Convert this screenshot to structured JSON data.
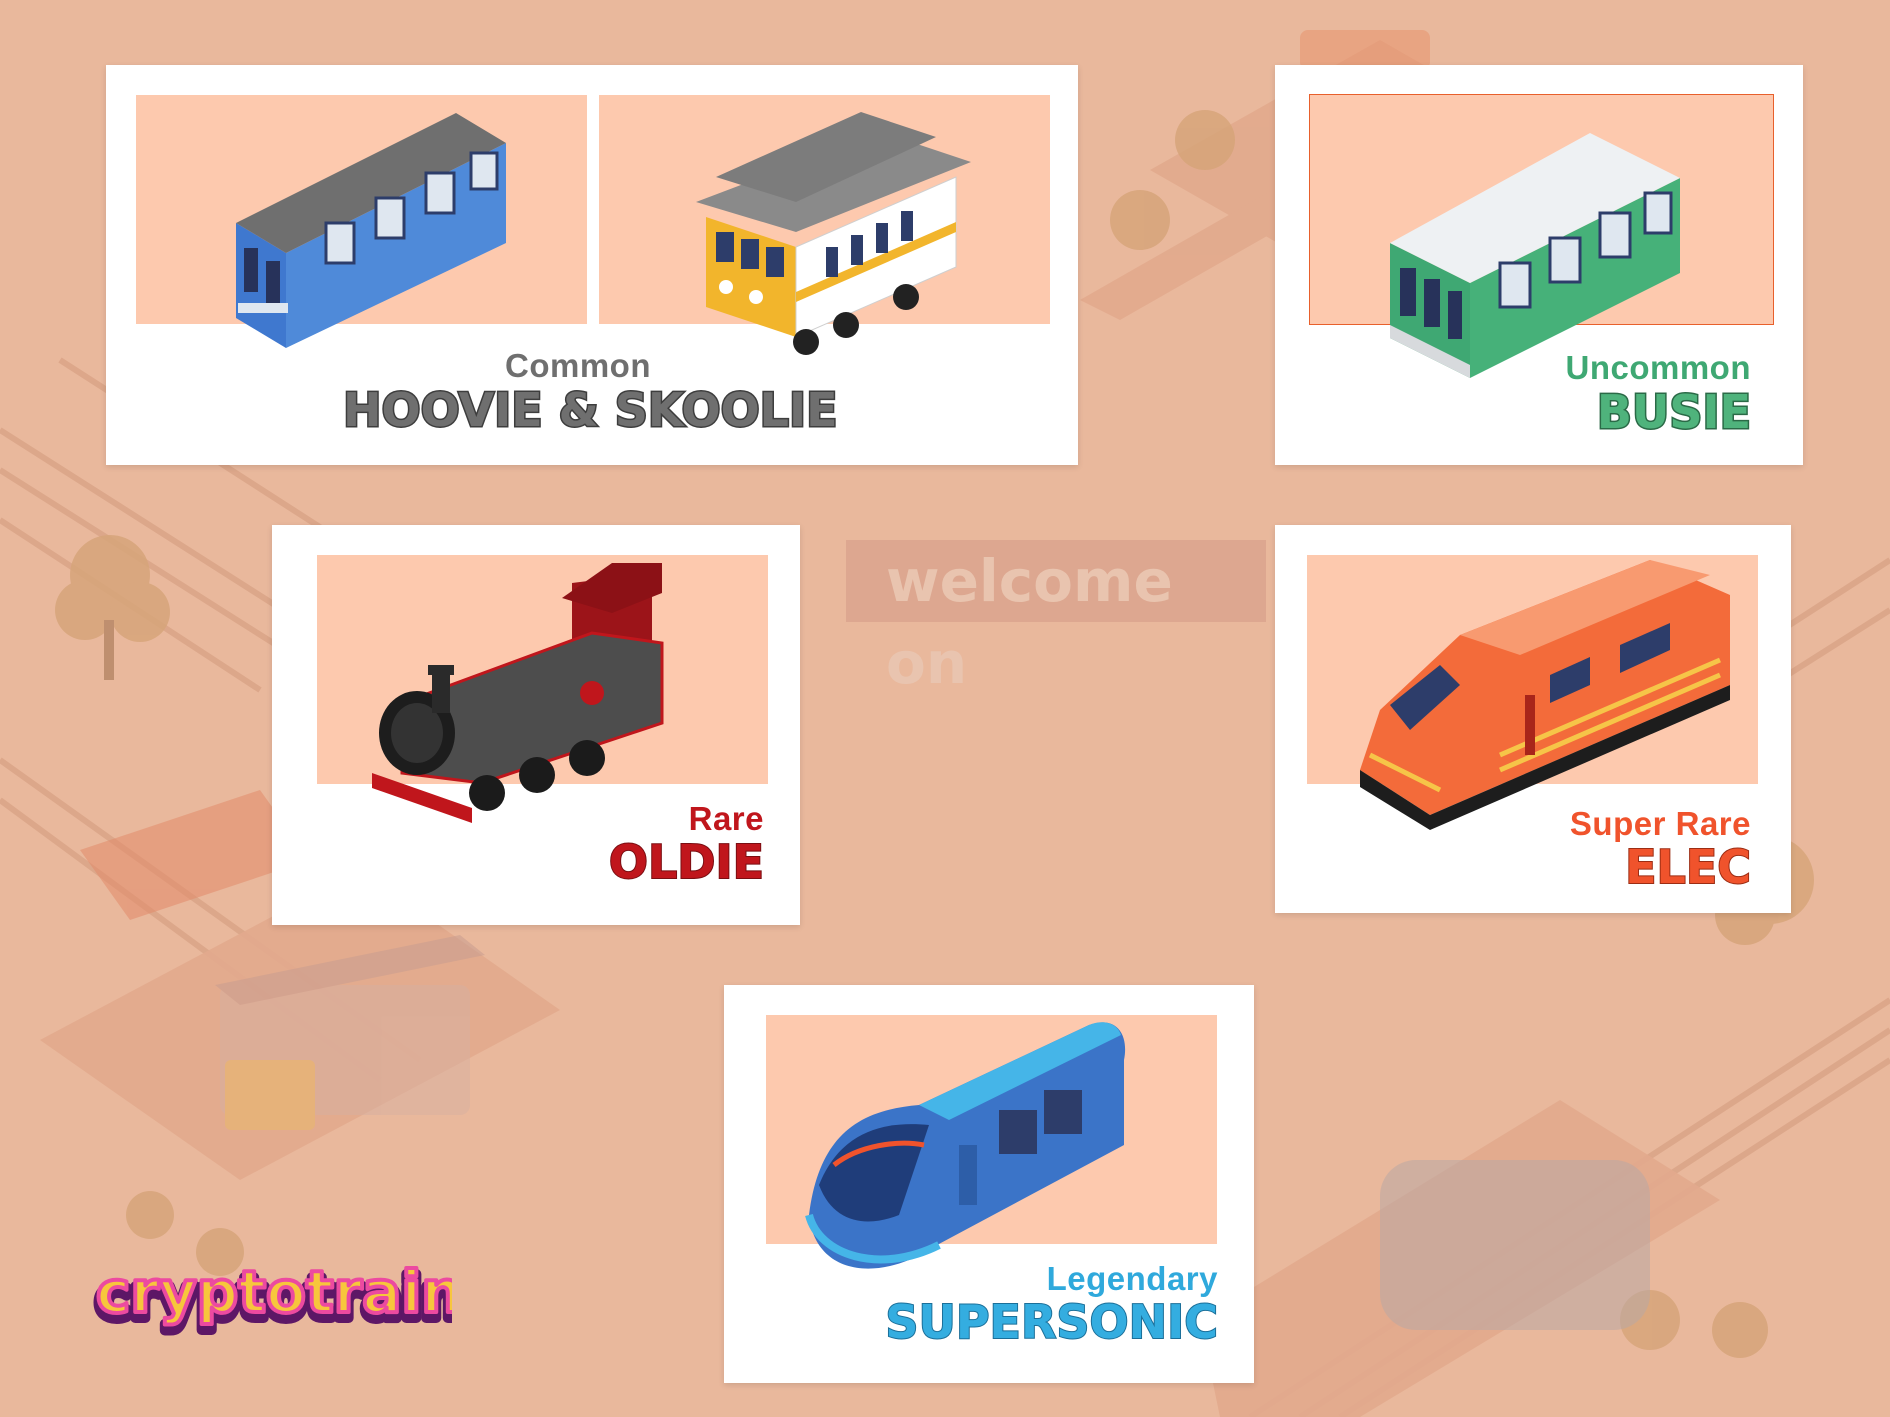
{
  "background": {
    "color": "#e9b89c",
    "sign_text": "welcome on"
  },
  "logo": {
    "text": "cryptotrains"
  },
  "cards": [
    {
      "id": "common",
      "rarity": "Common",
      "name": "HOOVIE & SKOOLIE",
      "rarity_color": "#6f6f6f",
      "name_color": "#6f6f6f",
      "trains": [
        "blue-commuter-car-icon",
        "yellow-tram-icon"
      ]
    },
    {
      "id": "uncommon",
      "rarity": "Uncommon",
      "name": "BUSIE",
      "rarity_color": "#3fa873",
      "name_color": "#4fb37c",
      "trains": [
        "green-bus-car-icon"
      ]
    },
    {
      "id": "rare",
      "rarity": "Rare",
      "name": "OLDIE",
      "rarity_color": "#c0161c",
      "name_color": "#c0161c",
      "trains": [
        "steam-locomotive-icon"
      ]
    },
    {
      "id": "super-rare",
      "rarity": "Super Rare",
      "name": "ELEC",
      "rarity_color": "#f0532c",
      "name_color": "#f0532c",
      "trains": [
        "orange-electric-train-icon"
      ]
    },
    {
      "id": "legendary",
      "rarity": "Legendary",
      "name": "SUPERSONIC",
      "rarity_color": "#2fa9dc",
      "name_color": "#34ade0",
      "trains": [
        "blue-bullet-train-icon"
      ]
    }
  ]
}
